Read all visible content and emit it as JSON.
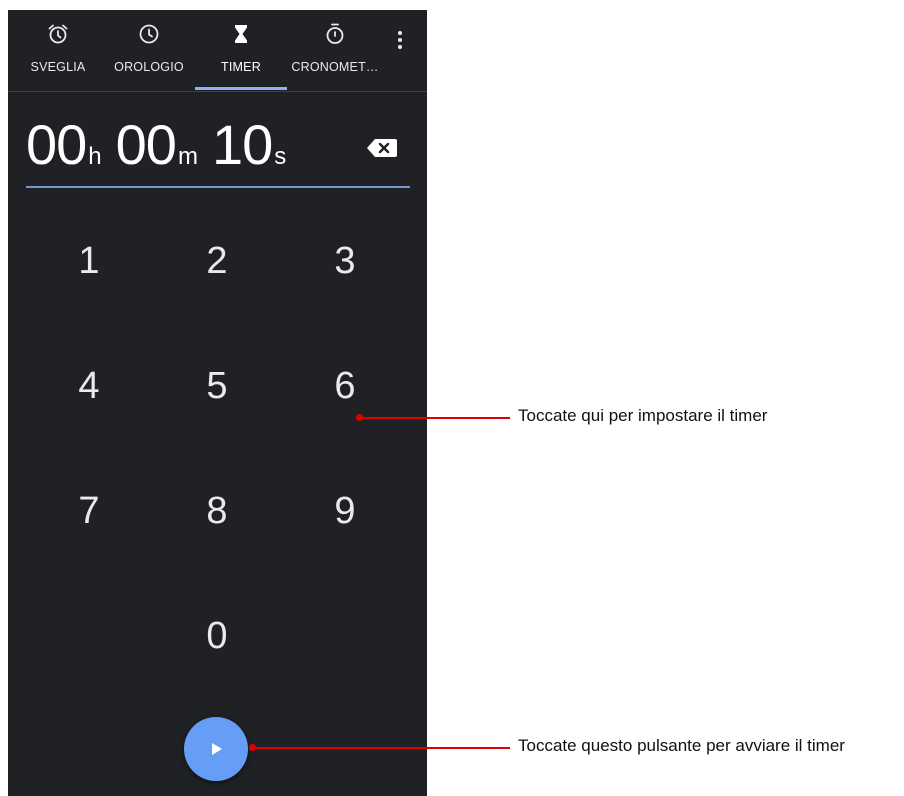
{
  "tabs": [
    {
      "label": "SVEGLIA",
      "icon": "alarm-clock-icon"
    },
    {
      "label": "OROLOGIO",
      "icon": "clock-icon"
    },
    {
      "label": "TIMER",
      "icon": "hourglass-icon",
      "active": true
    },
    {
      "label": "CRONOMET…",
      "icon": "stopwatch-icon"
    }
  ],
  "timer": {
    "hours": "00",
    "hours_unit": "h",
    "minutes": "00",
    "minutes_unit": "m",
    "seconds": "10",
    "seconds_unit": "s"
  },
  "keypad": [
    "1",
    "2",
    "3",
    "4",
    "5",
    "6",
    "7",
    "8",
    "9",
    "0"
  ],
  "callouts": {
    "keypad": "Toccate qui per impostare il timer",
    "start": "Toccate questo pulsante per avviare il timer"
  },
  "colors": {
    "background": "#202124",
    "accent": "#8ab4f8",
    "fab": "#669df6",
    "callout": "#e00000"
  }
}
